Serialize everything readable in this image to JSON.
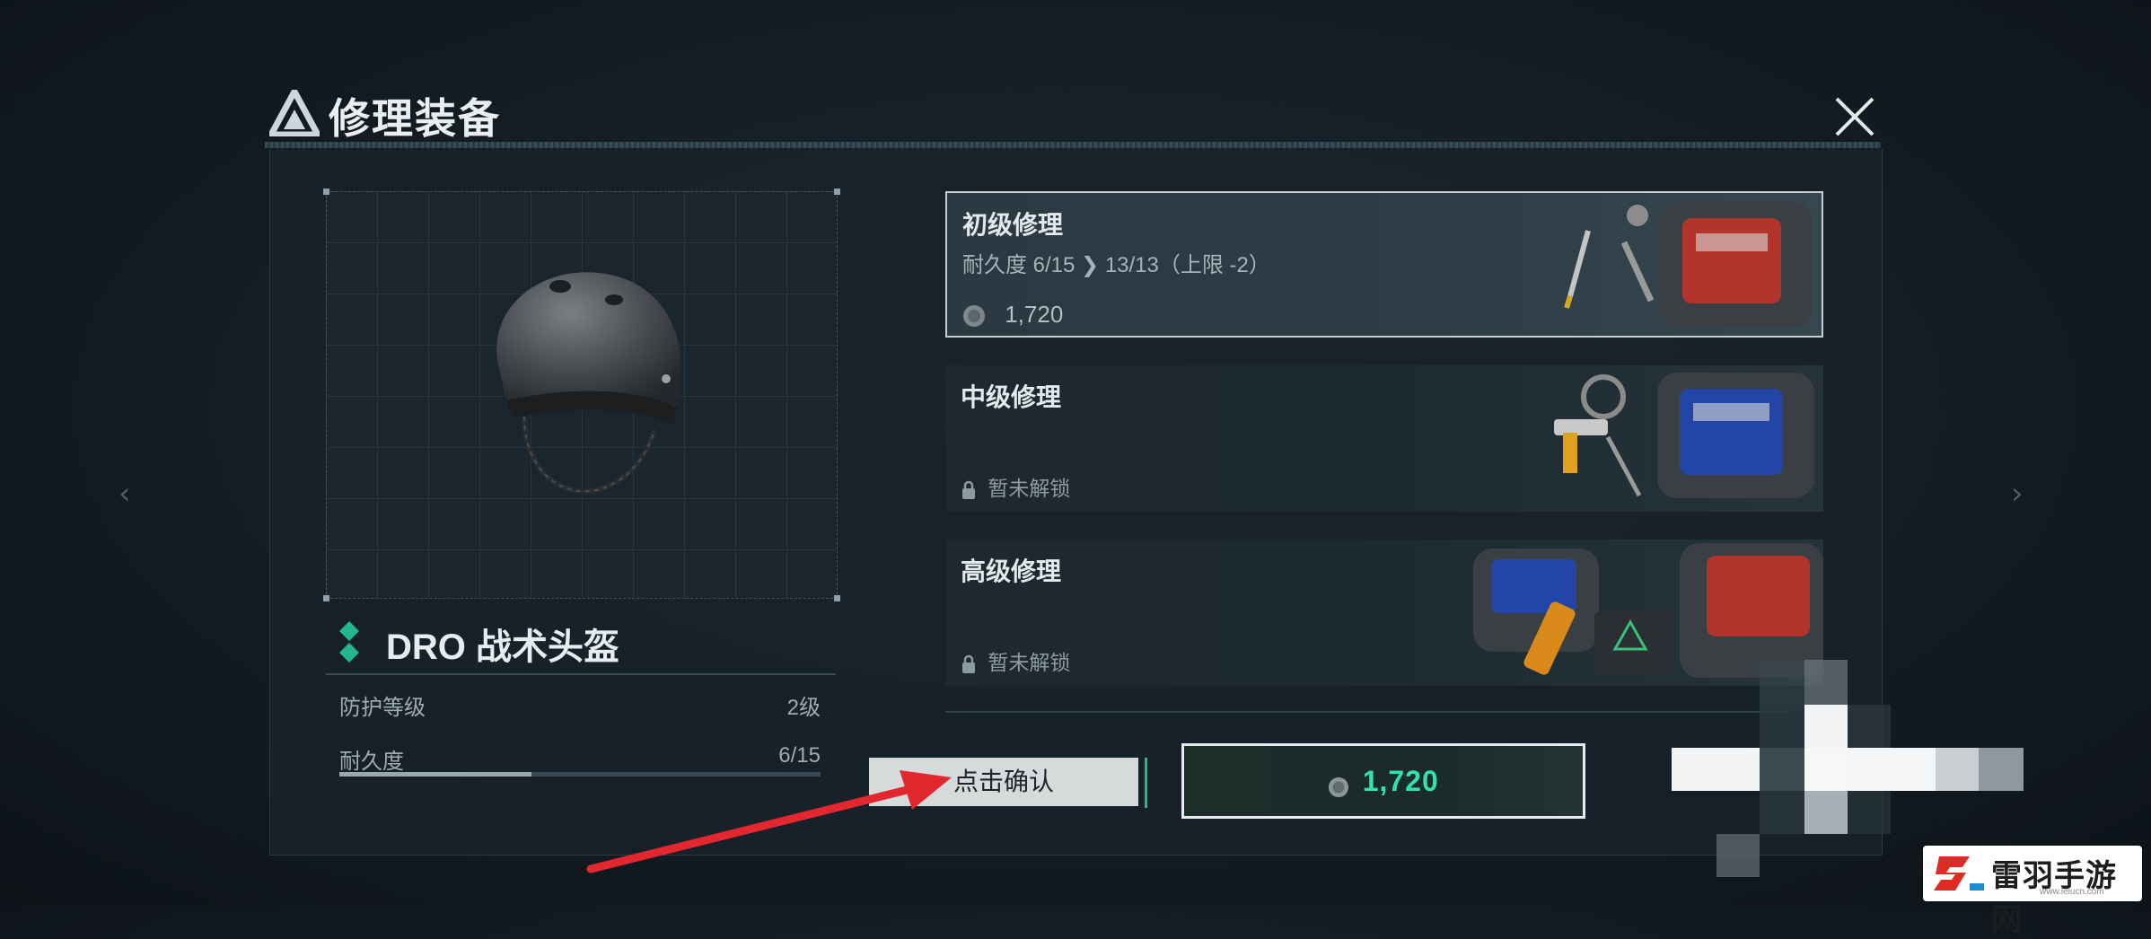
{
  "window": {
    "title": "修理装备"
  },
  "item": {
    "name": "DRO 战术头盔",
    "stats": [
      {
        "label": "防护等级",
        "value": "2级"
      },
      {
        "label": "耐久度",
        "value": "6/15"
      }
    ],
    "durability_fraction": 0.4
  },
  "repair_options": [
    {
      "title": "初级修理",
      "desc": "耐久度 6/15 ❯ 13/13（上限 -2）",
      "cost": "1,720",
      "state": "selected"
    },
    {
      "title": "中级修理",
      "lock_text": "暂未解锁",
      "state": "locked"
    },
    {
      "title": "高级修理",
      "lock_text": "暂未解锁",
      "state": "locked"
    }
  ],
  "confirm": {
    "hint": "点击确认",
    "price": "1,720"
  },
  "watermark": {
    "text": "雷羽手游网",
    "url": "www.leiucn.com"
  },
  "colors": {
    "accent_green": "#31e3a6",
    "annotation_red": "#e0282e",
    "rarity_green": "#1fb98d"
  },
  "icons": [
    "game-logo-icon",
    "close-icon",
    "rarity-icon",
    "coin-icon",
    "lock-icon",
    "chevron-left-icon",
    "chevron-right-icon"
  ]
}
